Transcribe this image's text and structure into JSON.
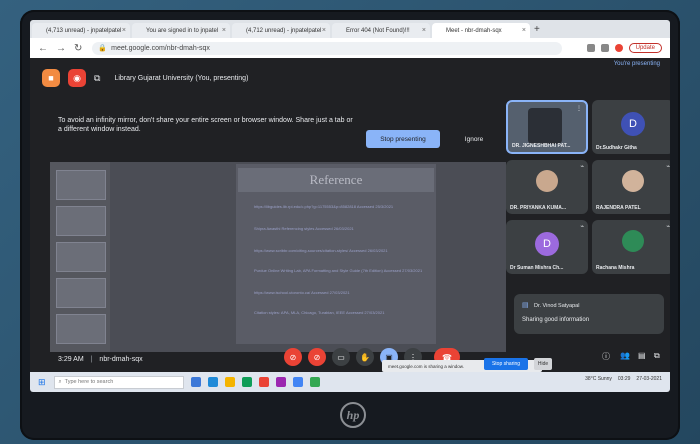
{
  "browser": {
    "tabs": [
      {
        "label": "(4,713 unread) - jnpatelpatel",
        "color": "#4a6fd8",
        "active": false
      },
      {
        "label": "You are signed in to jnpatel",
        "color": "#2b3a8f",
        "active": false
      },
      {
        "label": "(4,712 unread) - jnpatelpatel",
        "color": "#4a6fd8",
        "active": false
      },
      {
        "label": "Error 404 (Not Found)!!!",
        "color": "#777777",
        "active": false
      },
      {
        "label": "Meet - nbr-dmah-sqx",
        "color": "#0f9d58",
        "active": true
      }
    ],
    "new_tab": "+",
    "url": "meet.google.com/nbr-dmah-sqx",
    "update_label": "Update"
  },
  "meet": {
    "presenting_link": "You're presenting",
    "present_title": "Library Gujarat University (You, presenting)",
    "warning": "To avoid an infinity mirror, don't share your entire screen or browser window. Share just a tab or a different window instead.",
    "stop_presenting": "Stop presenting",
    "ignore": "Ignore",
    "slide_title": "Reference",
    "reference_lines": [
      "https://libguides.lib.rpi.edu/c.php?g=1175553&p=8582818 Accessed 25/3/2021",
      "Shipra Awasthi Referencing styles Accessed 26/03/2021",
      "https://www.scribbr.com/citing-sources/citation-styles/ Accessed 26/03/2021",
      "Purdue Online Writing Lab, APA Formatting and Style Guide (7th Edition) Accessed 27/03/2021",
      "https://www.ischool.utoronto.ca/ Accessed 27/03/2021",
      "Citation styles: APA, MLA, Chicago, Turabian, IEEE Accessed 27/03/2021"
    ],
    "participants": [
      {
        "name": "DR. JIGNESHBHAI PAT...",
        "initial": "",
        "kind": "video"
      },
      {
        "name": "Dr.Sudhakr Githa",
        "initial": "D",
        "kind": "avatar",
        "color": "#3f51b5"
      },
      {
        "name": "DR. PRIYANKA KUMA...",
        "initial": "",
        "kind": "photo",
        "color": "#c9a88e"
      },
      {
        "name": "RAJENDRA PATEL",
        "initial": "",
        "kind": "photo",
        "color": "#d1b39b"
      },
      {
        "name": "Dr Suman Mishra Ch...",
        "initial": "D",
        "kind": "avatar",
        "color": "#9c6ade"
      },
      {
        "name": "Rachana Mishra",
        "initial": "",
        "kind": "photo",
        "color": "#2e8b57"
      }
    ],
    "chat": {
      "sender": "Dr. Vinod Satyapal",
      "message": "Sharing good information"
    },
    "time": "3:29 AM",
    "divider": "|",
    "meeting_code": "nbr-dmah-sqx",
    "share_notice": "meet.google.com is sharing a window.",
    "stop_sharing": "Stop sharing",
    "hide": "Hide",
    "controls": [
      {
        "name": "mic-off",
        "color": "#ea4335",
        "glyph": "⊘"
      },
      {
        "name": "camera-off",
        "color": "#ea4335",
        "glyph": "⊘"
      },
      {
        "name": "captions",
        "color": "#3c4043",
        "glyph": "▭"
      },
      {
        "name": "raise-hand",
        "color": "#3c4043",
        "glyph": "✋"
      },
      {
        "name": "present",
        "color": "#8ab4f8",
        "glyph": "▣"
      },
      {
        "name": "more-options",
        "color": "#3c4043",
        "glyph": "⋮"
      }
    ]
  },
  "taskbar": {
    "search_placeholder": "Type here to search",
    "tray_text": "38°C Sunny",
    "clock": "03:29",
    "date": "27-03-2021",
    "icons": [
      "#3c78d8",
      "#1f8ad8",
      "#f4b400",
      "#0f9d58",
      "#ea4335",
      "#9c27b0",
      "#4285f4",
      "#34a853"
    ]
  }
}
